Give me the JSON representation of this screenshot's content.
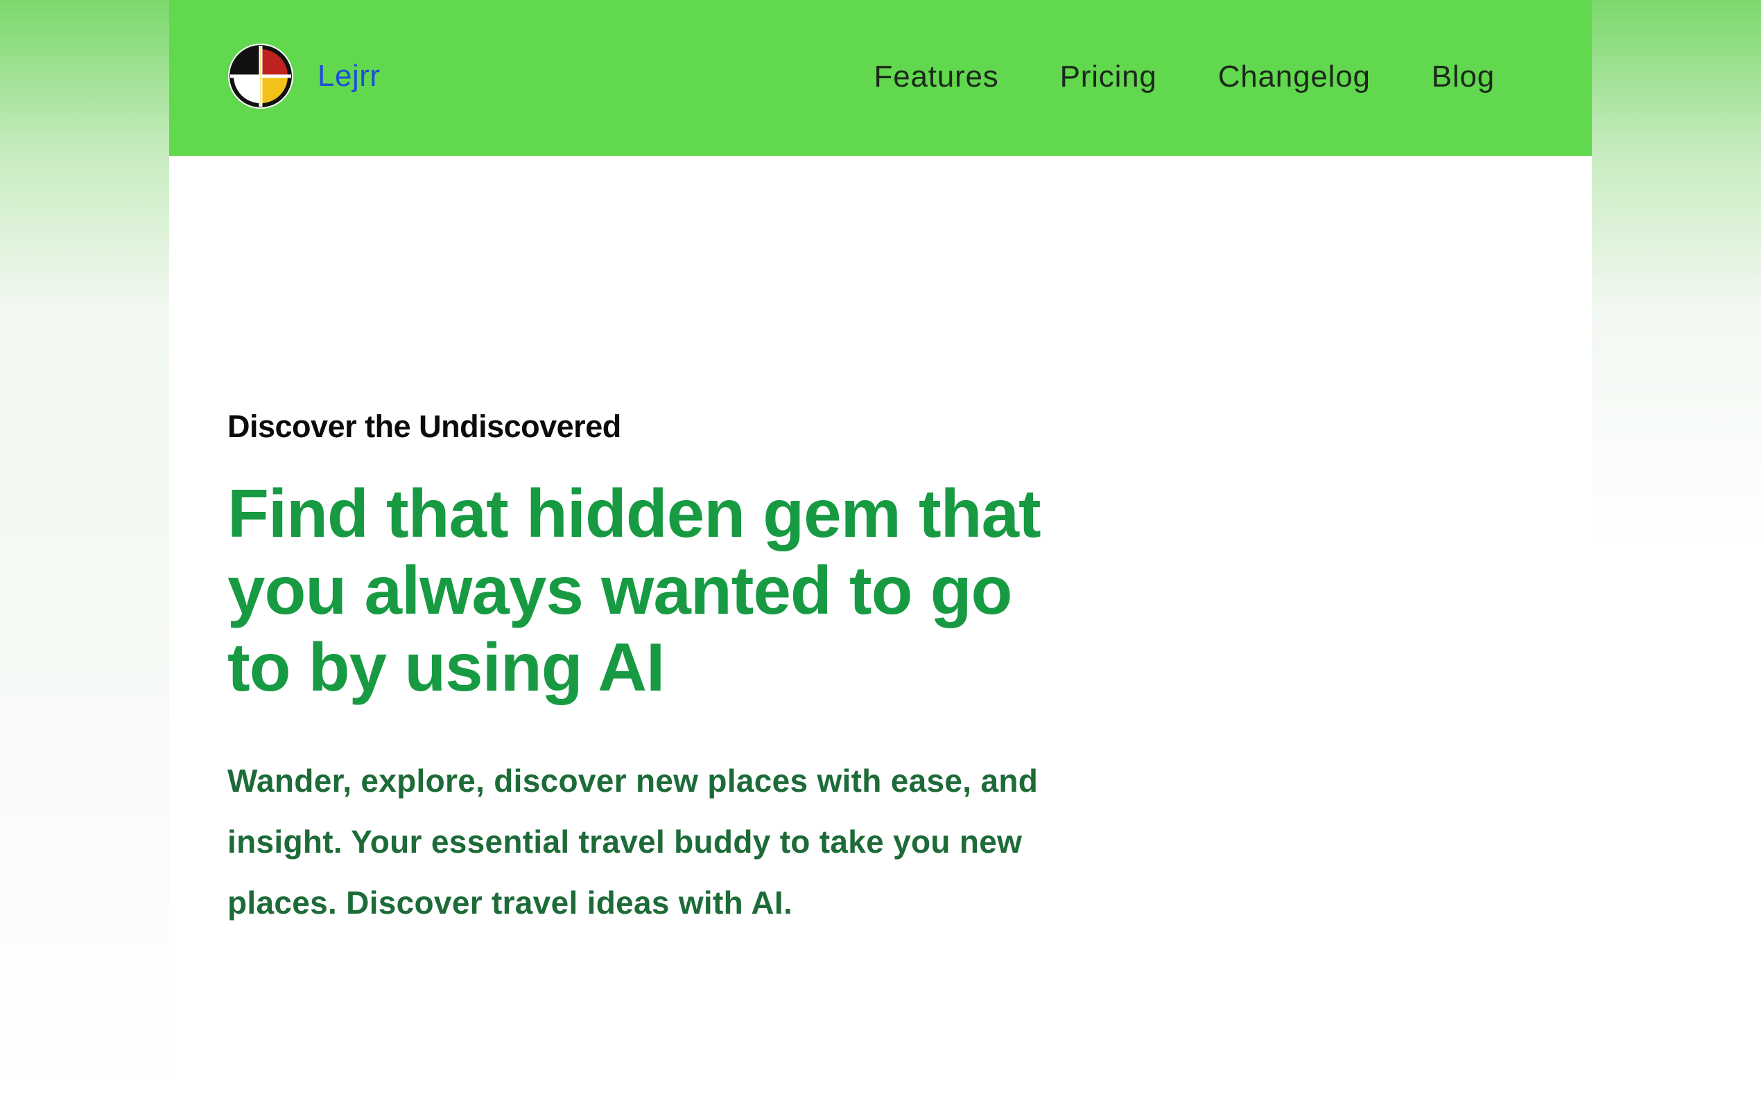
{
  "header": {
    "brand_name": "Lejrr",
    "logo_icon": "medicine-wheel-logo-icon",
    "nav": [
      {
        "label": "Features"
      },
      {
        "label": "Pricing"
      },
      {
        "label": "Changelog"
      },
      {
        "label": "Blog"
      }
    ]
  },
  "hero": {
    "eyebrow": "Discover the Undiscovered",
    "headline": "Find that hidden gem that you always wanted to go to by using AI",
    "subtext": "Wander, explore, discover new places with ease, and insight. Your essential travel buddy to take you new places. Discover travel ideas with AI."
  },
  "colors": {
    "navbar_bg": "#62d84e",
    "brand_link": "#1f4fd6",
    "headline": "#179a42",
    "subtext": "#1d6b38"
  }
}
